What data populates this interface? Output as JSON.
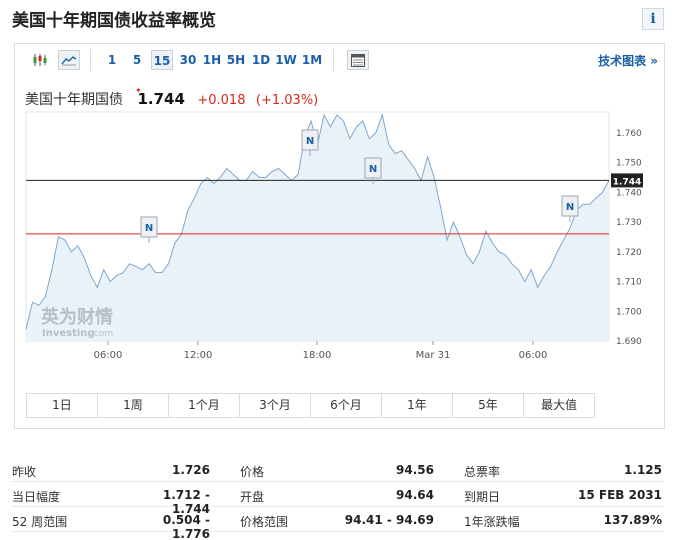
{
  "page": {
    "title": "美国十年期国债收益率概览",
    "info_icon_text": "i"
  },
  "toolbar": {
    "icons": [
      "candlestick-icon",
      "area-chart-icon",
      "calendar-grid-icon"
    ],
    "intervals": [
      "1",
      "5",
      "15",
      "30",
      "1H",
      "5H",
      "1D",
      "1W",
      "1M"
    ],
    "active_interval": "15",
    "tech_link": "技术图表 »"
  },
  "quote": {
    "name": "美国十年期国债",
    "price": "1.744",
    "change": "+0.018",
    "change_pct": "(+1.03%)",
    "marker": "✦",
    "current_label": "1.744"
  },
  "watermark": {
    "cn": "英为财情",
    "en": "Investing",
    "suffix": ".com"
  },
  "chart_data": {
    "type": "area",
    "x_labels": [
      "06:00",
      "12:00",
      "18:00",
      "Mar 31",
      "06:00"
    ],
    "y_ticks": [
      "1.760",
      "1.750",
      "1.740",
      "1.730",
      "1.720",
      "1.710",
      "1.700",
      "1.690"
    ],
    "ylim": [
      1.69,
      1.767
    ],
    "last_value": 1.744,
    "prev_close": 1.726,
    "news_markers": [
      "N",
      "N",
      "N",
      "N"
    ],
    "series": [
      {
        "values": [
          1.694,
          1.703,
          1.702,
          1.705,
          1.714,
          1.725,
          1.724,
          1.72,
          1.722,
          1.718,
          1.712,
          1.708,
          1.714,
          1.71,
          1.712,
          1.713,
          1.716,
          1.715,
          1.714,
          1.716,
          1.713,
          1.713,
          1.716,
          1.723,
          1.726,
          1.734,
          1.738,
          1.743,
          1.745,
          1.743,
          1.745,
          1.748,
          1.746,
          1.744,
          1.744,
          1.747,
          1.745,
          1.745,
          1.747,
          1.748,
          1.746,
          1.744,
          1.746,
          1.758,
          1.764,
          1.756,
          1.766,
          1.762,
          1.766,
          1.764,
          1.758,
          1.762,
          1.764,
          1.758,
          1.76,
          1.766,
          1.756,
          1.753,
          1.754,
          1.751,
          1.748,
          1.744,
          1.752,
          1.745,
          1.735,
          1.724,
          1.73,
          1.725,
          1.719,
          1.716,
          1.72,
          1.727,
          1.723,
          1.72,
          1.719,
          1.716,
          1.714,
          1.71,
          1.714,
          1.708,
          1.712,
          1.715,
          1.72,
          1.724,
          1.728,
          1.734,
          1.736,
          1.736,
          1.738,
          1.74,
          1.744
        ]
      }
    ]
  },
  "ranges": [
    "1日",
    "1周",
    "1个月",
    "3个月",
    "6个月",
    "1年",
    "5年",
    "最大值"
  ],
  "stats": [
    [
      {
        "label": "昨收",
        "value": "1.726"
      },
      {
        "label": "价格",
        "value": "94.56"
      },
      {
        "label": "总票率",
        "value": "1.125"
      }
    ],
    [
      {
        "label": "当日幅度",
        "value": "1.712 - 1.744"
      },
      {
        "label": "开盘",
        "value": "94.64"
      },
      {
        "label": "到期日",
        "value": "15 FEB 2031"
      }
    ],
    [
      {
        "label": "52 周范围",
        "value": "0.504 - 1.776"
      },
      {
        "label": "价格范围",
        "value": "94.41 - 94.69"
      },
      {
        "label": "1年涨跌幅",
        "value": "137.89%"
      }
    ]
  ],
  "colors": {
    "accent": "#1a5fa8",
    "up": "#d8281e",
    "line": "#7fa7cf",
    "area": "#eaf2f9"
  }
}
